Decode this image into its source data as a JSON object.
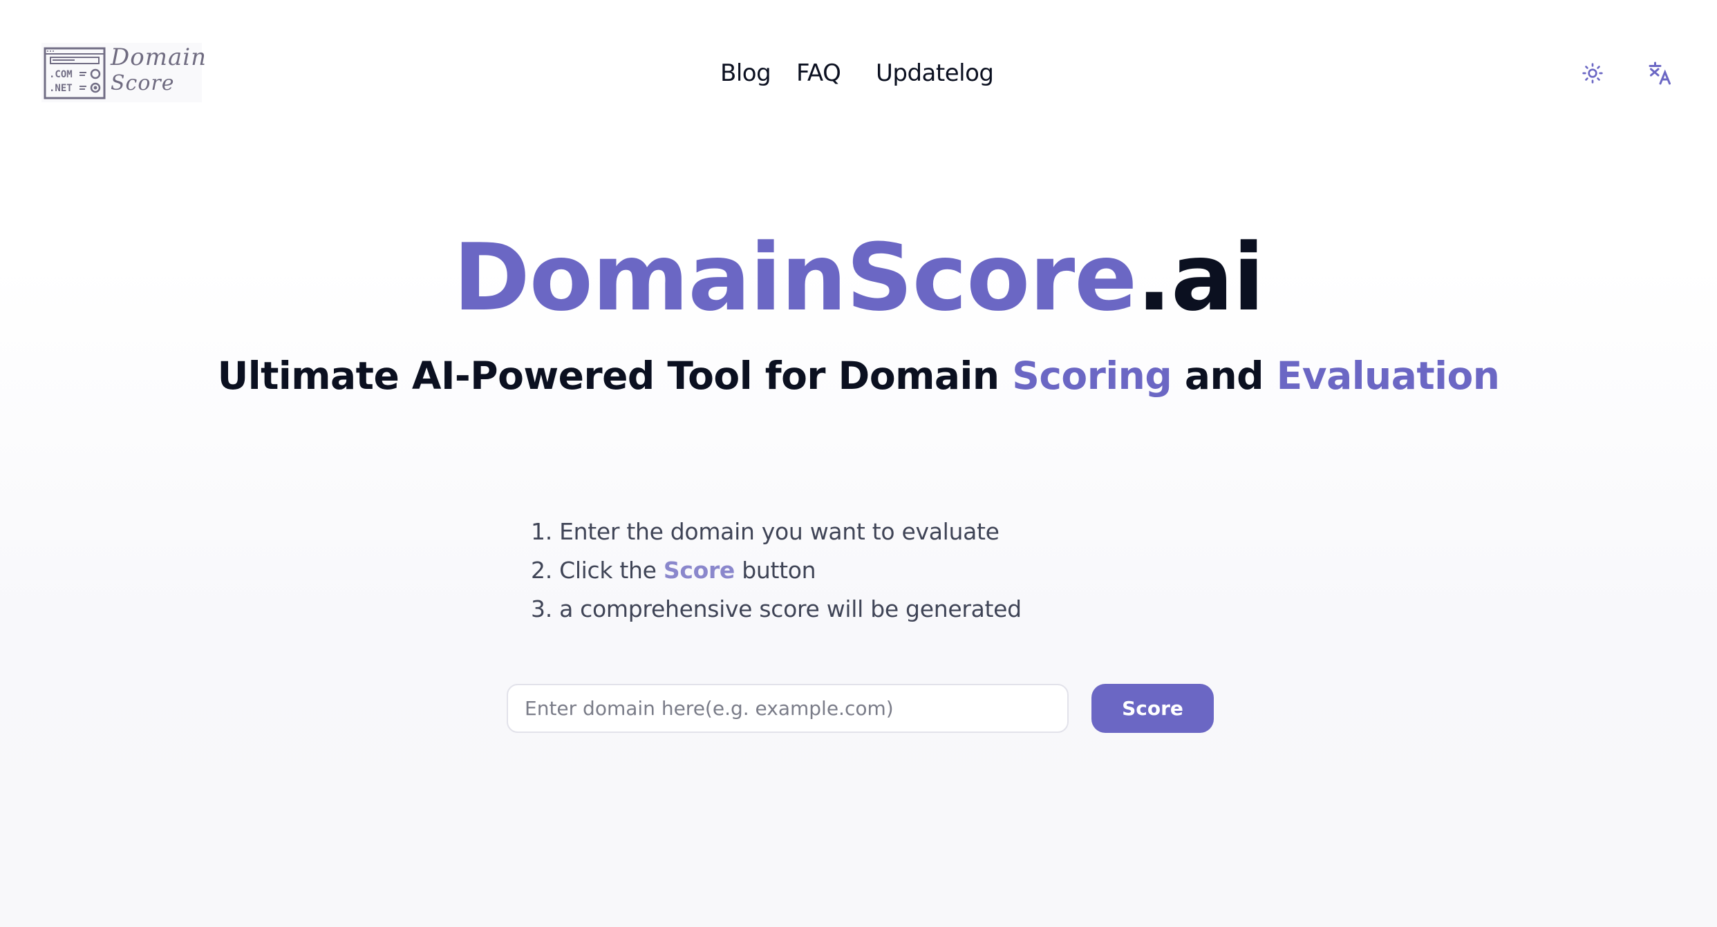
{
  "header": {
    "logo": {
      "line1": "Domain",
      "line2": "Score",
      "mark_labels": [
        ".COM",
        ".NET"
      ],
      "icon": "domain-browser-logo-icon"
    },
    "nav": [
      {
        "label": "Blog"
      },
      {
        "label": "FAQ"
      },
      {
        "label": "Updatelog"
      }
    ],
    "actions": [
      {
        "icon": "sun-icon",
        "label": "Toggle theme"
      },
      {
        "icon": "translate-icon",
        "label": "Language"
      }
    ]
  },
  "hero": {
    "title_brand": "DomainScore",
    "title_tld": ".ai",
    "subtitle": {
      "part1": "Ultimate AI-Powered Tool for Domain ",
      "highlight1": "Scoring",
      "part2": " and ",
      "highlight2": "Evaluation"
    }
  },
  "steps": [
    {
      "text": "1. Enter the domain you want to evaluate"
    },
    {
      "prefix": "2. Click the ",
      "highlight": "Score",
      "suffix": " button"
    },
    {
      "text": "3. a comprehensive score will be generated"
    }
  ],
  "search": {
    "value": "",
    "placeholder": "Enter domain here(e.g. example.com)",
    "button_label": "Score"
  },
  "colors": {
    "accent": "#6b67c4",
    "text_dark": "#0b1020",
    "text_muted": "#3f4456",
    "step_highlight": "#8a87cc"
  }
}
